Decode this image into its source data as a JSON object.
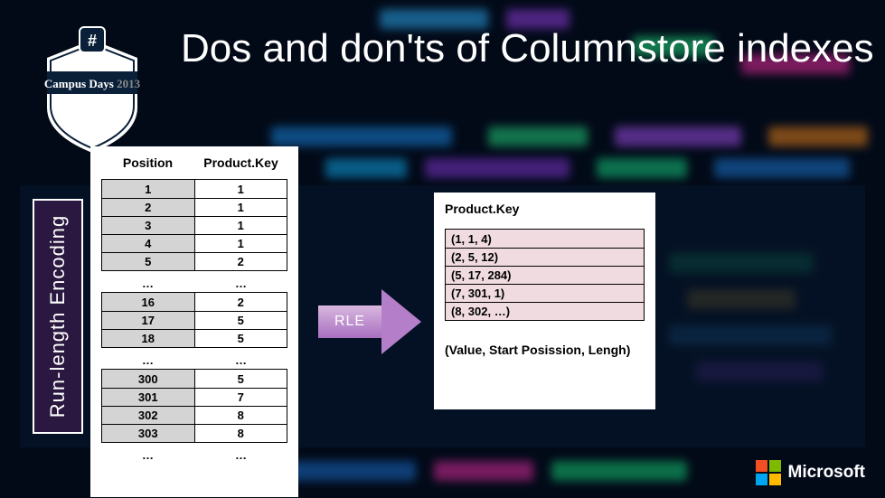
{
  "slide": {
    "title": "Dos and don'ts of Columnstore indexes",
    "sidebar_label": "Run-length Encoding",
    "badge": {
      "event_name": "Campus Days",
      "year": "2013",
      "hash_symbol": "#"
    },
    "arrow_label": "RLE",
    "footer_logo": "Microsoft"
  },
  "left_table": {
    "headers": {
      "col1": "Position",
      "col2": "Product.Key"
    },
    "group1": [
      {
        "pos": "1",
        "val": "1"
      },
      {
        "pos": "2",
        "val": "1"
      },
      {
        "pos": "3",
        "val": "1"
      },
      {
        "pos": "4",
        "val": "1"
      },
      {
        "pos": "5",
        "val": "2"
      }
    ],
    "gap1": {
      "pos": "…",
      "val": "…"
    },
    "group2": [
      {
        "pos": "16",
        "val": "2"
      },
      {
        "pos": "17",
        "val": "5"
      },
      {
        "pos": "18",
        "val": "5"
      }
    ],
    "gap2": {
      "pos": "…",
      "val": "…"
    },
    "group3": [
      {
        "pos": "300",
        "val": "5"
      },
      {
        "pos": "301",
        "val": "7"
      },
      {
        "pos": "302",
        "val": "8"
      },
      {
        "pos": "303",
        "val": "8"
      }
    ],
    "gap3": {
      "pos": "…",
      "val": "…"
    }
  },
  "right_table": {
    "header": "Product.Key",
    "rows": [
      "(1, 1, 4)",
      "(2, 5, 12)",
      "(5, 17, 284)",
      "(7, 301, 1)",
      "(8, 302, …)"
    ],
    "legend": "(Value, Start Posission, Lengh)"
  },
  "colors": {
    "ms_red": "#f25022",
    "ms_green": "#7fba00",
    "ms_blue": "#00a4ef",
    "ms_yellow": "#ffb900"
  }
}
